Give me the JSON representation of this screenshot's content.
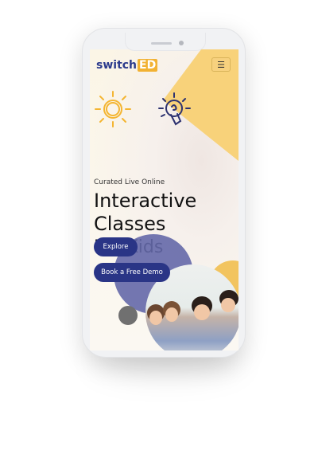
{
  "brand": {
    "logo_text": "switch",
    "logo_badge": "ED"
  },
  "nav": {
    "menu_icon": "hamburger-icon"
  },
  "hero": {
    "eyebrow": "Curated Live Online",
    "title_line1": "Interactive",
    "title_line2": "Classes",
    "title_line3": "For Kids"
  },
  "buttons": {
    "explore": "Explore",
    "demo": "Book a Free Demo"
  },
  "colors": {
    "accent_yellow": "#f8d27a",
    "button_blue": "#2a3586",
    "circle_blue": "#6468a8"
  }
}
